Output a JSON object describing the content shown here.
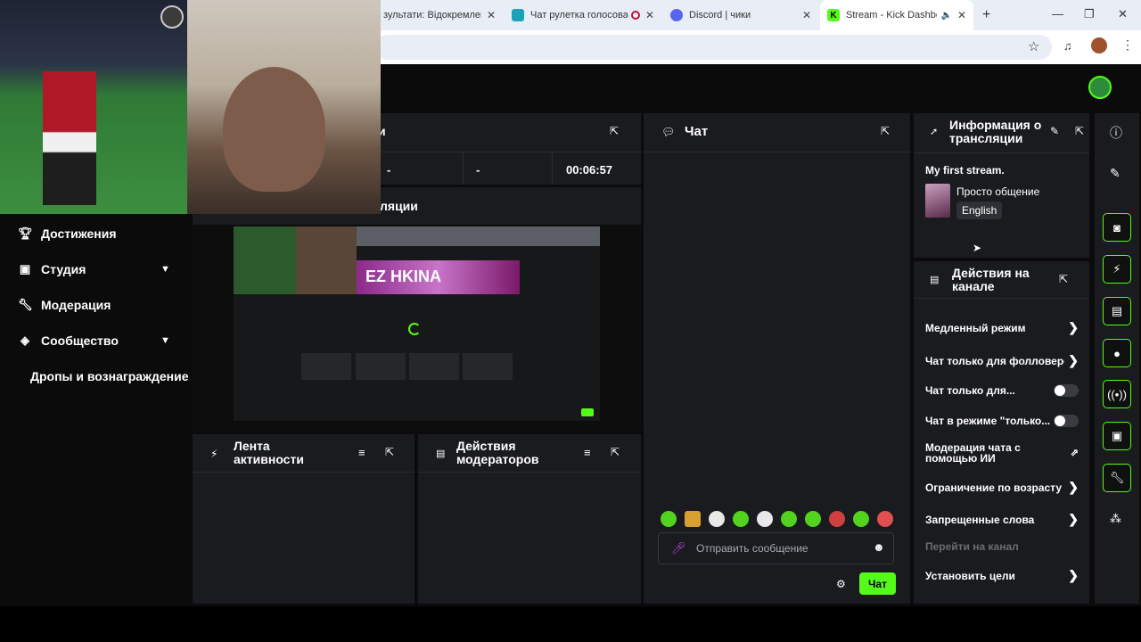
{
  "tabs": [
    {
      "label": "зультати: Відокремлені",
      "icon": "result-page-icon"
    },
    {
      "label": "Чат рулетка голосова",
      "icon": "chat-roulette-icon"
    },
    {
      "label": "Discord | чики",
      "icon": "discord-icon"
    },
    {
      "label": "Stream - Kick Dashboa",
      "icon": "kick-icon",
      "active": true
    }
  ],
  "stream": {
    "section_title_partial": "и",
    "stat1": "-",
    "stat2": "-",
    "uptime": "00:06:57",
    "preview_title_partial": "ляции",
    "preview_overlay_text": "EZ HKINA"
  },
  "sidebar": {
    "items": [
      {
        "label": "Достижения",
        "icon": "trophy-icon"
      },
      {
        "label": "Студия",
        "icon": "studio-icon",
        "expandable": true
      },
      {
        "label": "Модерация",
        "icon": "wrench-icon"
      },
      {
        "label": "Сообщество",
        "icon": "community-icon",
        "expandable": true
      },
      {
        "label": "Дропы и вознаграждение",
        "icon": ""
      }
    ]
  },
  "activity": {
    "title": "Лента активности"
  },
  "modlog": {
    "title": "Действия модераторов"
  },
  "chat": {
    "title": "Чат",
    "placeholder": "Отправить сообщение",
    "send_label": "Чат"
  },
  "info": {
    "title": "Информация о трансляции",
    "stream_title": "My first stream.",
    "category": "Просто общение",
    "language": "English"
  },
  "channel_actions": {
    "title": "Действия на канале",
    "items": [
      {
        "label": "Медленный режим",
        "control": "arrow"
      },
      {
        "label": "Чат только для фолловерс",
        "control": "arrow"
      },
      {
        "label": "Чат только для...",
        "control": "toggle"
      },
      {
        "label": "Чат в режиме \"только...",
        "control": "toggle"
      },
      {
        "label": "Модерация чата с помощью ИИ",
        "control": "external"
      },
      {
        "label": "Ограничение по возрасту",
        "control": "arrow"
      },
      {
        "label": "Запрещенные слова",
        "control": "arrow"
      },
      {
        "label": "Перейти на канал",
        "control": "none",
        "disabled": true
      },
      {
        "label": "Установить цели",
        "control": "arrow"
      }
    ]
  },
  "colors": {
    "accent": "#53fc18",
    "panel": "#191b1f",
    "background": "#0b0b0c"
  }
}
